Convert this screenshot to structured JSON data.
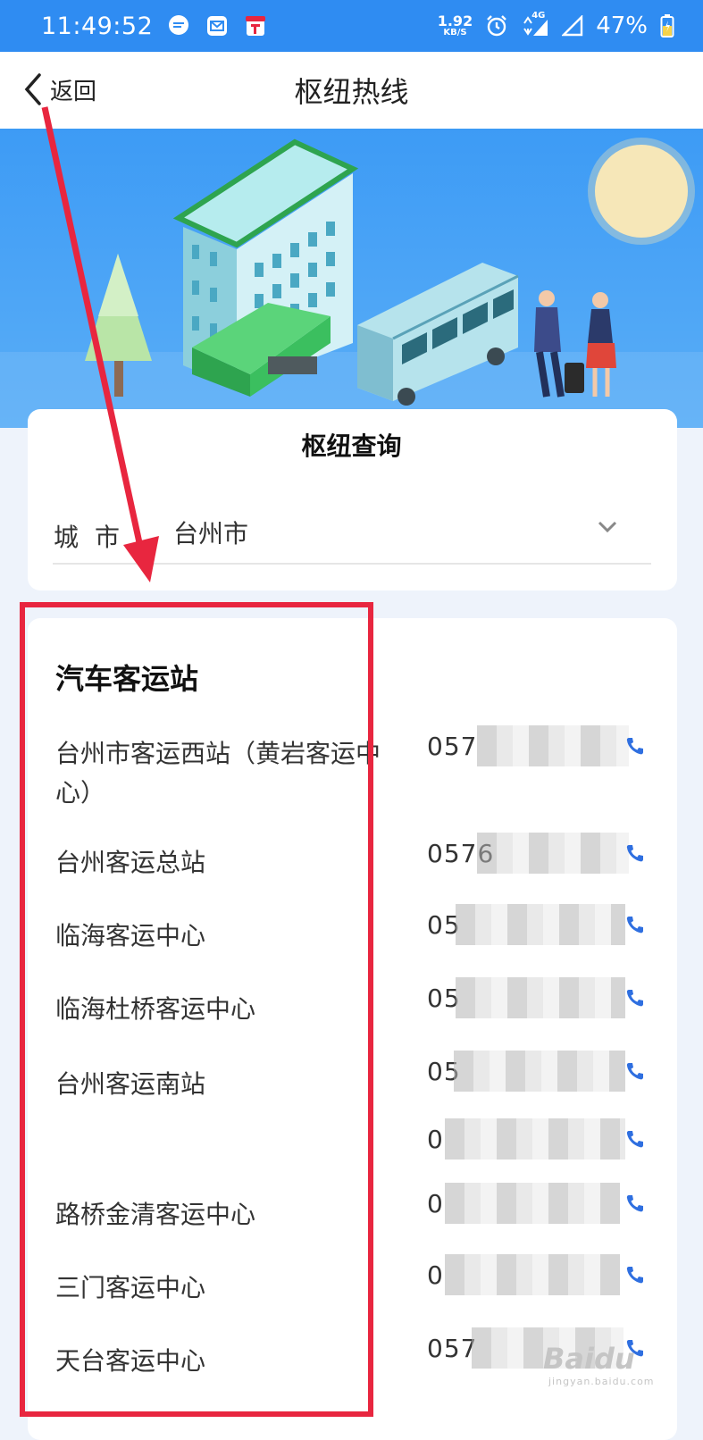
{
  "status_bar": {
    "time": "11:49:52",
    "net_speed": "1.92",
    "net_unit": "KB/S",
    "network": "4G",
    "battery": "47%"
  },
  "nav": {
    "back_label": "返回",
    "title": "枢纽热线"
  },
  "query": {
    "title": "枢纽查询",
    "city_label": "城市",
    "city_value": "台州市"
  },
  "section": {
    "title": "汽车客运站"
  },
  "stations": [
    {
      "name": "台州市客运西站（黄岩客运中心）",
      "phone_prefix": "057"
    },
    {
      "name": "台州客运总站",
      "phone_prefix": "0576"
    },
    {
      "name": "临海客运中心",
      "phone_prefix": "05"
    },
    {
      "name": "临海杜桥客运中心",
      "phone_prefix": "05"
    },
    {
      "name": "台州客运南站",
      "phone_prefix": "05"
    },
    {
      "name": "",
      "phone_prefix": "0"
    },
    {
      "name": "路桥金清客运中心",
      "phone_prefix": "0"
    },
    {
      "name": "三门客运中心",
      "phone_prefix": "0"
    },
    {
      "name": "天台客运中心",
      "phone_prefix": "057"
    }
  ],
  "watermark": {
    "text": "Baidu",
    "sub": "jingyan.baidu.com"
  },
  "colors": {
    "status_bar": "#2f8cf2",
    "annotation_red": "#e8263f",
    "phone_icon": "#2f6fe0"
  }
}
